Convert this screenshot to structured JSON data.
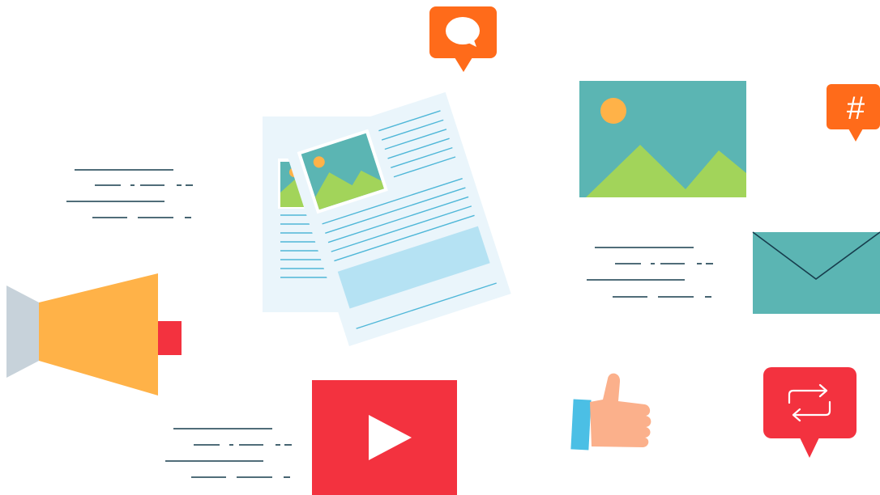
{
  "illustration": {
    "icons": [
      "megaphone-icon",
      "documents-icon",
      "speech-bubble-icon",
      "landscape-image-icon",
      "hashtag-bubble-icon",
      "envelope-icon",
      "play-button-icon",
      "thumbs-up-icon",
      "repost-bubble-icon"
    ],
    "hashtag_glyph": "#"
  },
  "colors": {
    "orange": "#ff6b1a",
    "teal": "#5bb5b3",
    "green": "#a2d45a",
    "sun": "#ffb248",
    "red": "#f3323f",
    "navy": "#173d4d",
    "paper": "#eaf5fb",
    "paper_lines": "#4fb7d8",
    "paper_block": "#b5e2f3",
    "megaphone_body": "#ffb248",
    "megaphone_mouth": "#c7d2da",
    "skin": "#fbb08b",
    "sleeve": "#4bbfe5"
  }
}
